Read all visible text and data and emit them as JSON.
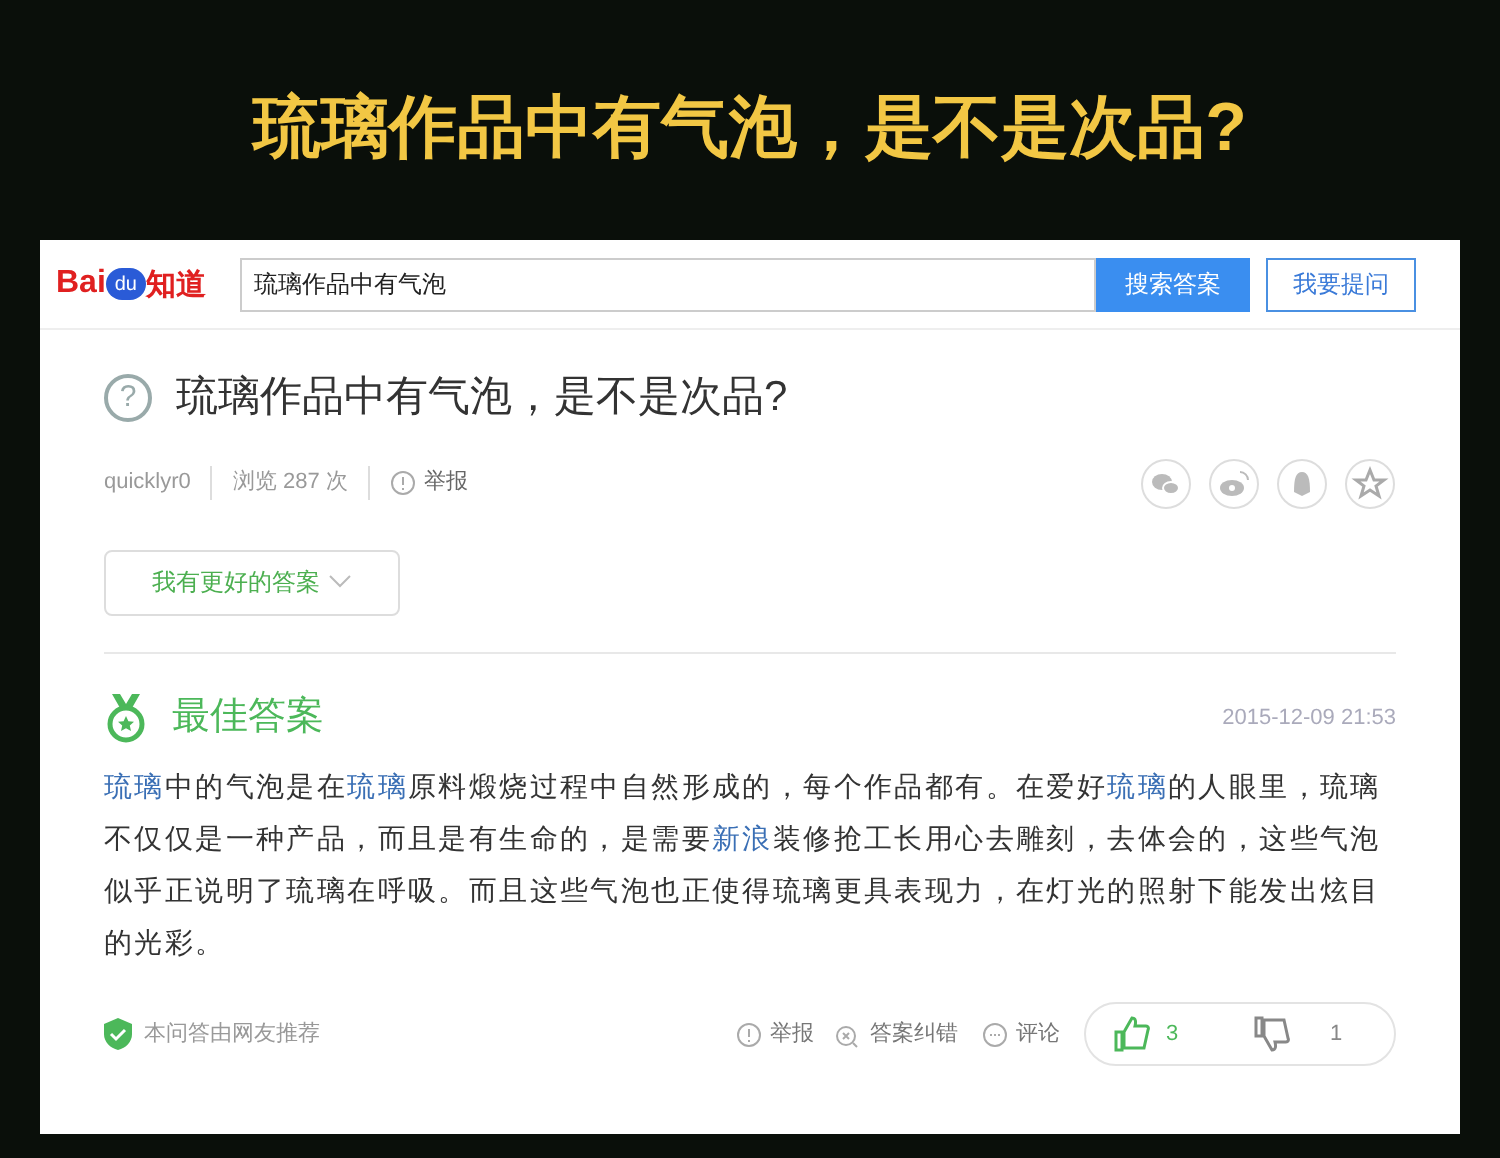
{
  "headline": "琉璃作品中有气泡，是不是次品?",
  "logo": {
    "left": "Bai",
    "paw": "du",
    "right": "知道"
  },
  "search": {
    "value": "琉璃作品中有气泡",
    "search_button": "搜索答案",
    "ask_button": "我要提问"
  },
  "question": {
    "icon": "?",
    "title": "琉璃作品中有气泡，是不是次品?",
    "user": "quicklyr0",
    "views": "浏览 287 次",
    "report": "举报"
  },
  "better_answer_button": "我有更好的答案",
  "best_answer": {
    "title": "最佳答案",
    "time": "2015-12-09 21:53",
    "segments": [
      {
        "text": "琉璃",
        "link": true
      },
      {
        "text": "中的气泡是在",
        "link": false
      },
      {
        "text": "琉璃",
        "link": true
      },
      {
        "text": "原料煅烧过程中自然形成的，每个作品都有。在爱好",
        "link": false
      },
      {
        "text": "琉璃",
        "link": true
      },
      {
        "text": "的人眼里，琉璃不仅仅是一种产品，而且是有生命的，是需要",
        "link": false
      },
      {
        "text": "新浪",
        "link": true
      },
      {
        "text": "装修抢工长用心去雕刻，去体会的，这些气泡似乎正说明了琉璃在呼吸。而且这些气泡也正使得琉璃更具表现力，在灯光的照射下能发出炫目的光彩。",
        "link": false
      }
    ],
    "recommend": "本问答由网友推荐",
    "report": "举报",
    "correct": "答案纠错",
    "comment": "评论",
    "likes": "3",
    "dislikes": "1"
  }
}
